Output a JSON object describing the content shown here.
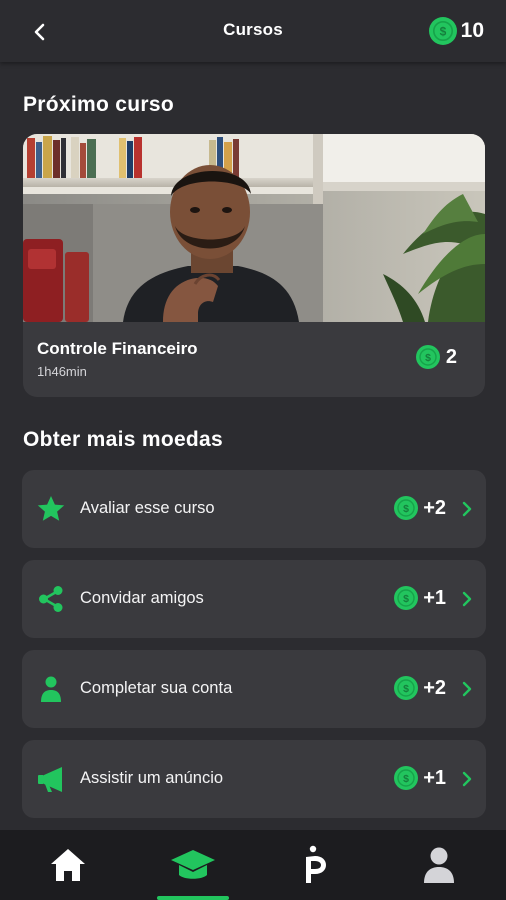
{
  "header": {
    "title": "Cursos",
    "balance": "10",
    "back_icon": "chevron-left-icon",
    "coin_icon": "dollar-coin-icon"
  },
  "next_course": {
    "section_title": "Próximo curso",
    "name": "Controle Financeiro",
    "duration": "1h46min",
    "coins": "2"
  },
  "earn_more": {
    "section_title": "Obter mais moedas",
    "items": [
      {
        "label": "Avaliar esse curso",
        "reward": "+2",
        "icon": "star-icon"
      },
      {
        "label": "Convidar amigos",
        "reward": "+1",
        "icon": "share-icon"
      },
      {
        "label": "Completar sua conta",
        "reward": "+2",
        "icon": "person-icon"
      },
      {
        "label": "Assistir um anúncio",
        "reward": "+1",
        "icon": "megaphone-icon"
      }
    ]
  },
  "bottom_nav": {
    "items": [
      {
        "name": "home",
        "icon": "home-icon"
      },
      {
        "name": "courses",
        "icon": "graduation-cap-icon",
        "active": true
      },
      {
        "name": "brand",
        "icon": "p-logo-icon"
      },
      {
        "name": "profile",
        "icon": "user-icon"
      }
    ]
  },
  "colors": {
    "background": "#2c2c30",
    "card": "#3a3a3e",
    "accent": "#22c55e",
    "nav_bg": "#1c1c1f"
  }
}
